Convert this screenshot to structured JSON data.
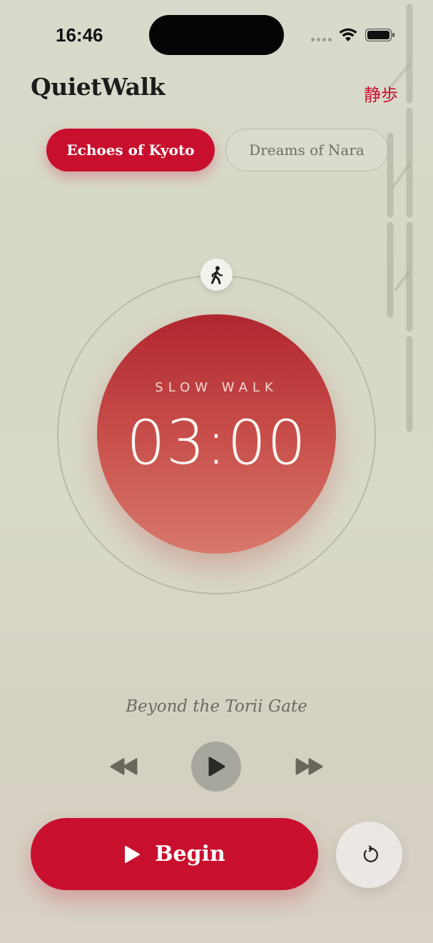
{
  "status_bar": {
    "time": "16:46"
  },
  "header": {
    "title": "QuietWalk",
    "subtitle": "静歩"
  },
  "tabs": [
    {
      "label": "Echoes of Kyoto",
      "active": true
    },
    {
      "label": "Dreams of Nara",
      "active": false
    }
  ],
  "timer": {
    "mode": "SLOW WALK",
    "time": "03:00"
  },
  "player": {
    "track_title": "Beyond the Torii Gate"
  },
  "actions": {
    "begin_label": "Begin"
  },
  "icons": {
    "walker": "figure-walk-icon",
    "rewind": "rewind-icon",
    "play": "play-icon",
    "forward": "fast-forward-icon",
    "reset": "reset-icon"
  },
  "colors": {
    "accent": "#c8102e",
    "background": "#d8d9ca",
    "disc_top": "#b1262f",
    "disc_bottom": "#d8786b"
  }
}
